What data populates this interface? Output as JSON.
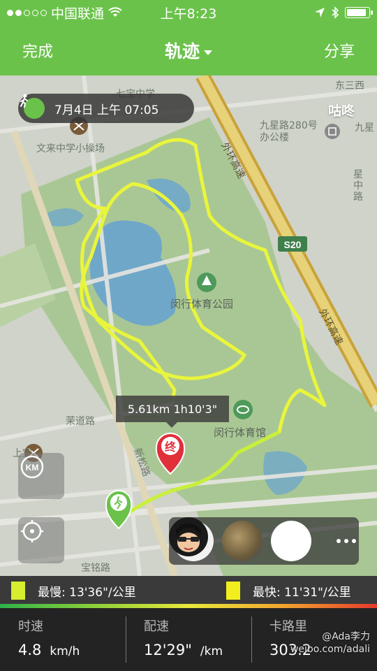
{
  "status_bar": {
    "carrier": "中国联通",
    "time": "上午8:23"
  },
  "nav": {
    "done_label": "完成",
    "title": "轨迹",
    "share_label": "分享"
  },
  "map": {
    "date_label": "7月4日 上午 07:05",
    "brand_label": "咕咚",
    "distance_tag": "5.61km 1h10'3\"",
    "end_marker": "终",
    "labels": {
      "school_top": "七宝中学",
      "school_field": "文来中学小操场",
      "office": "九星路280号办公楼",
      "jiuxing": "九星",
      "xingzhong": "星中路",
      "east_san": "东三西",
      "highway_outer": "外环高速",
      "highway_outer2": "外环高速",
      "s20": "S20",
      "park": "闵行体育公园",
      "stadium": "闵行体育馆",
      "xinsong": "新松路",
      "maolu": "茉道路",
      "shangzhou": "上宝",
      "baoyin": "宝铭路"
    }
  },
  "controls": {
    "km_label": "KM"
  },
  "pace": {
    "slowest": "最慢: 13'36\"/公里",
    "fastest": "最快: 11'31\"/公里",
    "slow_color": "#d7ee2e",
    "fast_color": "#f2ee1e"
  },
  "stats": {
    "speed_label": "时速",
    "speed_value": "4.8",
    "speed_unit": "km/h",
    "pace_label": "配速",
    "pace_value": "12'29\"",
    "pace_unit": "/km",
    "cal_label": "卡路里",
    "cal_value": "303.2"
  },
  "watermark": {
    "handle": "@Ada李力",
    "url": "weibo.com/adali"
  },
  "colors": {
    "accent": "#6bc24b",
    "track": "#e9f53c"
  }
}
